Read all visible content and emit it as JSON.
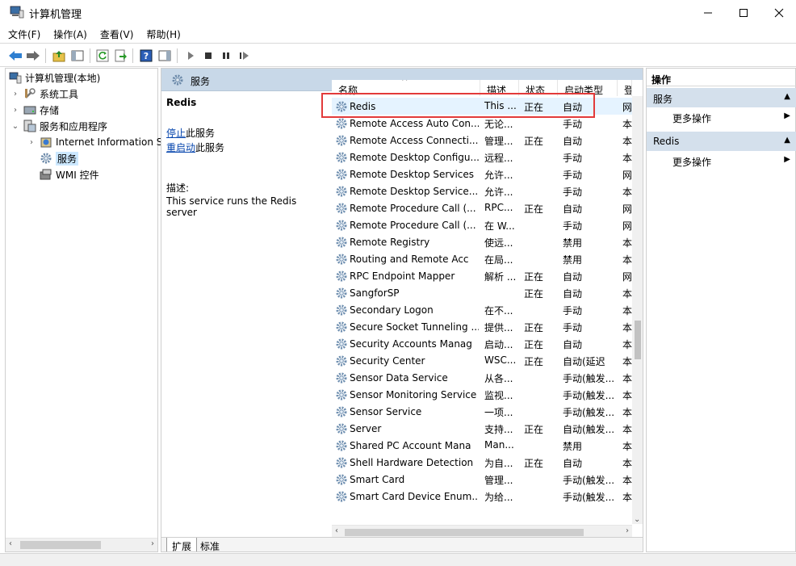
{
  "window": {
    "title": "计算机管理"
  },
  "menu": [
    "文件(F)",
    "操作(A)",
    "查看(V)",
    "帮助(H)"
  ],
  "tree": {
    "root": "计算机管理(本地)",
    "items": [
      {
        "label": "系统工具",
        "level": 1,
        "expander": "›"
      },
      {
        "label": "存储",
        "level": 1,
        "expander": "›"
      },
      {
        "label": "服务和应用程序",
        "level": 1,
        "expander": "⌄"
      },
      {
        "label": "Internet Information S",
        "level": 2,
        "expander": "›"
      },
      {
        "label": "服务",
        "level": 2,
        "expander": ""
      },
      {
        "label": "WMI 控件",
        "level": 2,
        "expander": ""
      }
    ]
  },
  "middle": {
    "header_title": "服务",
    "selected_service": "Redis",
    "stop_link": "停止",
    "stop_suffix": "此服务",
    "restart_link": "重启动",
    "restart_suffix": "此服务",
    "desc_label": "描述:",
    "desc_text": "This service runs the Redis server"
  },
  "columns": {
    "name": "名称",
    "desc": "描述",
    "status": "状态",
    "startup": "启动类型",
    "logon": "登"
  },
  "services": [
    {
      "name": "Redis",
      "desc": "This ...",
      "status": "正在",
      "startup": "自动",
      "logon": "网"
    },
    {
      "name": "Remote Access Auto Con...",
      "desc": "无论...",
      "status": "",
      "startup": "手动",
      "logon": "本"
    },
    {
      "name": "Remote Access Connecti...",
      "desc": "管理...",
      "status": "正在",
      "startup": "自动",
      "logon": "本"
    },
    {
      "name": "Remote Desktop Configu...",
      "desc": "远程...",
      "status": "",
      "startup": "手动",
      "logon": "本"
    },
    {
      "name": "Remote Desktop Services",
      "desc": "允许...",
      "status": "",
      "startup": "手动",
      "logon": "网"
    },
    {
      "name": "Remote Desktop Service...",
      "desc": "允许...",
      "status": "",
      "startup": "手动",
      "logon": "本"
    },
    {
      "name": "Remote Procedure Call (...",
      "desc": "RPC...",
      "status": "正在",
      "startup": "自动",
      "logon": "网"
    },
    {
      "name": "Remote Procedure Call (...",
      "desc": "在 W...",
      "status": "",
      "startup": "手动",
      "logon": "网"
    },
    {
      "name": "Remote Registry",
      "desc": "使远...",
      "status": "",
      "startup": "禁用",
      "logon": "本"
    },
    {
      "name": "Routing and Remote Acc",
      "desc": "在局...",
      "status": "",
      "startup": "禁用",
      "logon": "本"
    },
    {
      "name": "RPC Endpoint Mapper",
      "desc": "解析 ...",
      "status": "正在",
      "startup": "自动",
      "logon": "网"
    },
    {
      "name": "SangforSP",
      "desc": "",
      "status": "正在",
      "startup": "自动",
      "logon": "本"
    },
    {
      "name": "Secondary Logon",
      "desc": "在不...",
      "status": "",
      "startup": "手动",
      "logon": "本"
    },
    {
      "name": "Secure Socket Tunneling ...",
      "desc": "提供...",
      "status": "正在",
      "startup": "手动",
      "logon": "本"
    },
    {
      "name": "Security Accounts Manag",
      "desc": "启动...",
      "status": "正在",
      "startup": "自动",
      "logon": "本"
    },
    {
      "name": "Security Center",
      "desc": "WSC...",
      "status": "正在",
      "startup": "自动(延迟",
      "logon": "本"
    },
    {
      "name": "Sensor Data Service",
      "desc": "从各...",
      "status": "",
      "startup": "手动(触发...",
      "logon": "本"
    },
    {
      "name": "Sensor Monitoring Service",
      "desc": "监视...",
      "status": "",
      "startup": "手动(触发...",
      "logon": "本"
    },
    {
      "name": "Sensor Service",
      "desc": "一项...",
      "status": "",
      "startup": "手动(触发...",
      "logon": "本"
    },
    {
      "name": "Server",
      "desc": "支持...",
      "status": "正在",
      "startup": "自动(触发...",
      "logon": "本"
    },
    {
      "name": "Shared PC Account Mana",
      "desc": "Man...",
      "status": "",
      "startup": "禁用",
      "logon": "本"
    },
    {
      "name": "Shell Hardware Detection",
      "desc": "为自...",
      "status": "正在",
      "startup": "自动",
      "logon": "本"
    },
    {
      "name": "Smart Card",
      "desc": "管理...",
      "status": "",
      "startup": "手动(触发...",
      "logon": "本"
    },
    {
      "name": "Smart Card Device Enum...",
      "desc": "为给...",
      "status": "",
      "startup": "手动(触发...",
      "logon": "本"
    }
  ],
  "tabs": [
    "扩展",
    "标准"
  ],
  "actions": {
    "title": "操作",
    "groups": [
      {
        "label": "服务",
        "item": "更多操作"
      },
      {
        "label": "Redis",
        "item": "更多操作"
      }
    ]
  },
  "colors": {
    "accent": "#c8d8e8",
    "highlight_border": "#e23a3a",
    "link": "#0645ad",
    "selection": "#cce8ff"
  }
}
